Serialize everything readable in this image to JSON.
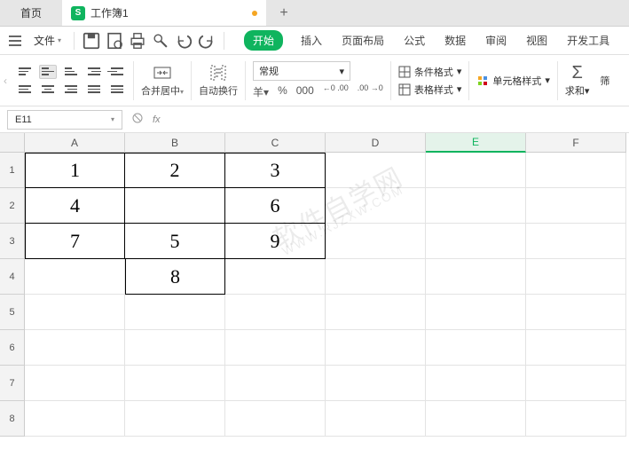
{
  "tabs": {
    "home": "首页",
    "file_name": "工作簿1",
    "file_icon": "S"
  },
  "menu": {
    "file": "文件",
    "items": [
      "开始",
      "插入",
      "页面布局",
      "公式",
      "数据",
      "审阅",
      "视图",
      "开发工具"
    ],
    "active": 0
  },
  "ribbon": {
    "merge": "合并居中",
    "wrap": "自动换行",
    "num_format": "常规",
    "currency": "羊",
    "percent": "%",
    "dec000": "000",
    "inc_dec": "←0\n.00",
    "dec_dec": ".00\n→0",
    "cond_fmt": "条件格式",
    "table_style": "表格样式",
    "cell_style": "单元格样式",
    "sum": "求和",
    "filter": "筛"
  },
  "formula_bar": {
    "cell_ref": "E11",
    "fx": "fx",
    "value": ""
  },
  "grid": {
    "cols": [
      "A",
      "B",
      "C",
      "D",
      "E",
      "F"
    ],
    "rows": [
      "1",
      "2",
      "3",
      "4",
      "5",
      "6",
      "7",
      "8"
    ],
    "selected_col": "E",
    "data": {
      "r1": {
        "A": "1",
        "B": "2",
        "C": "3"
      },
      "r2": {
        "A": "4",
        "B": "",
        "C": "6"
      },
      "r3": {
        "A": "7",
        "B": "5",
        "C": "9"
      },
      "r4": {
        "B": "8"
      }
    }
  },
  "watermark": "软件自学网"
}
